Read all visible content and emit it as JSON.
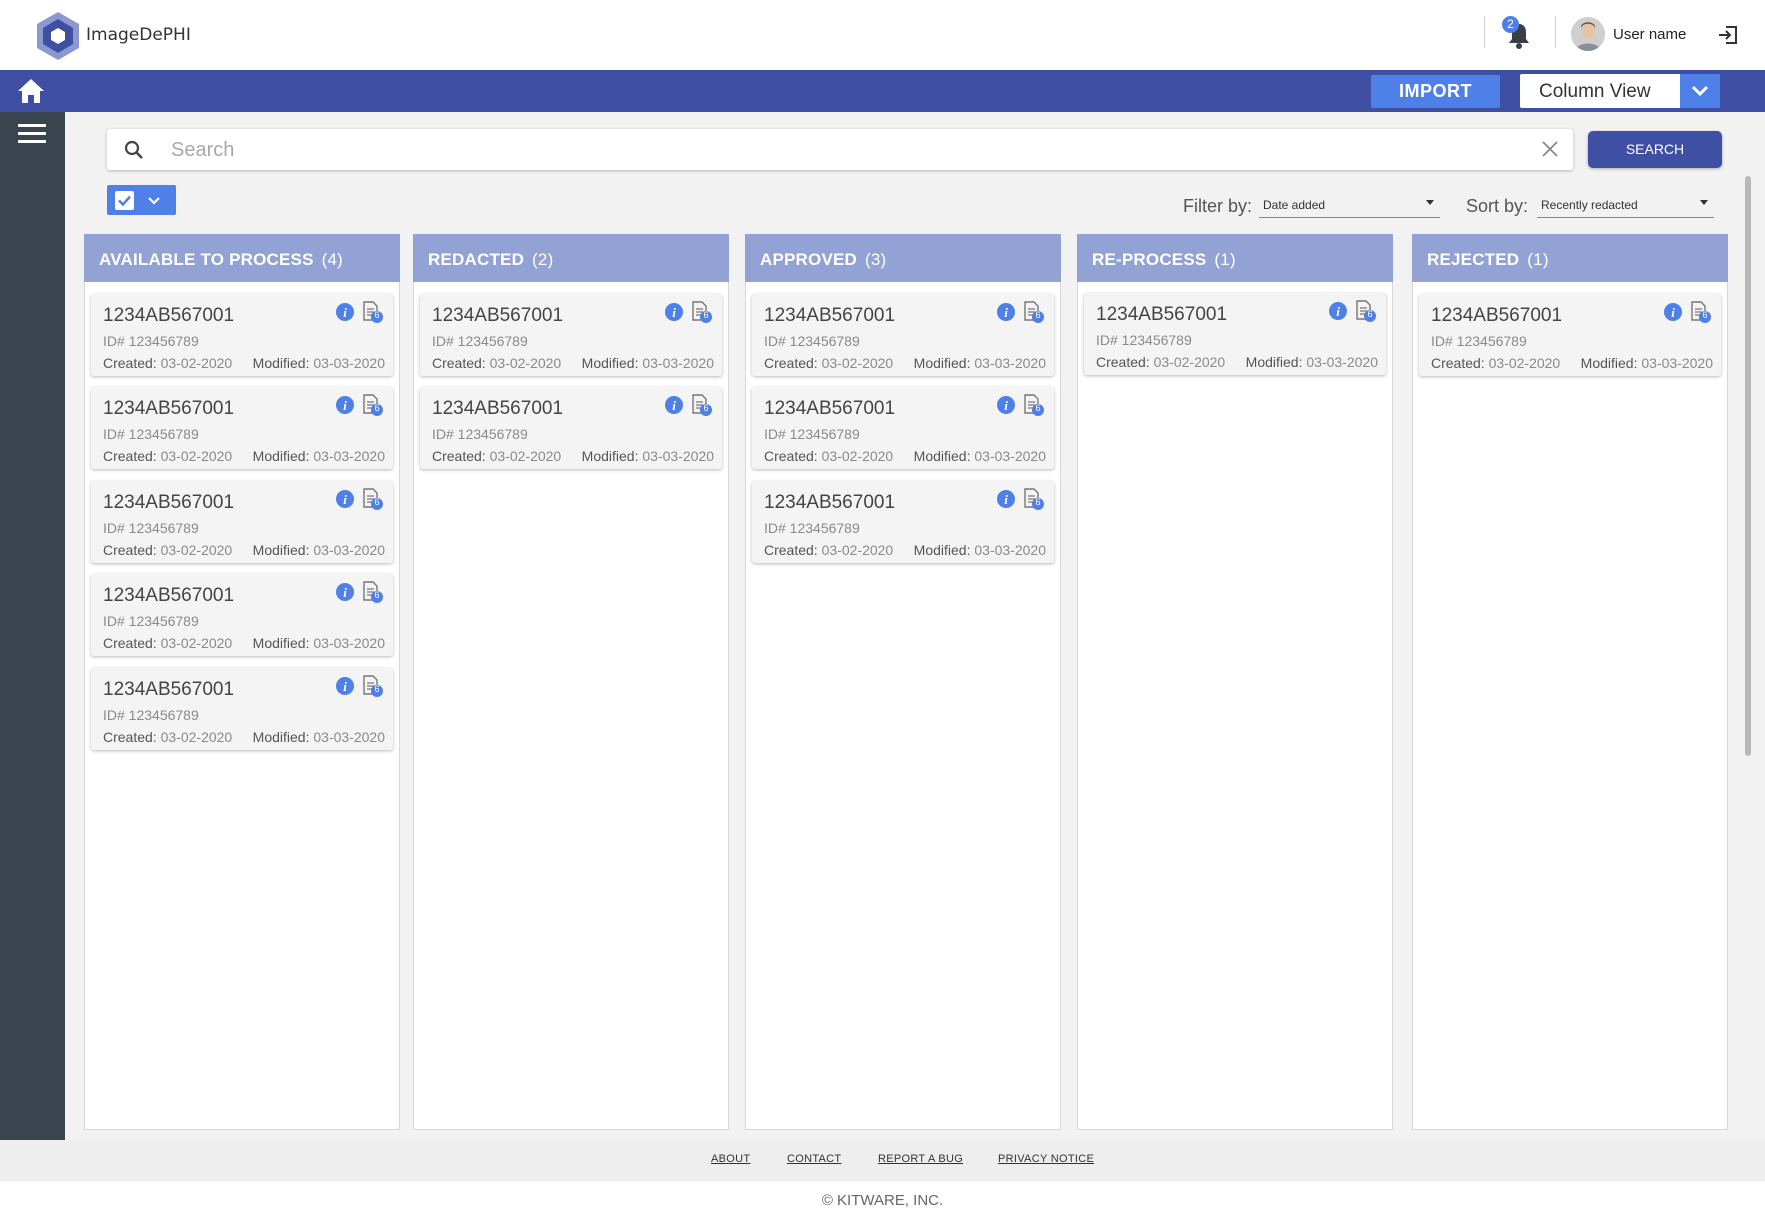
{
  "app": {
    "name": "ImageDePHI"
  },
  "header": {
    "notification_count": "2",
    "username": "User name"
  },
  "toolbar": {
    "import_label": "IMPORT",
    "view_selected": "Column View"
  },
  "search": {
    "placeholder": "Search",
    "button_label": "SEARCH"
  },
  "filter": {
    "label": "Filter by:",
    "value": "Date added"
  },
  "sort": {
    "label": "Sort by:",
    "value": "Recently redacted"
  },
  "card_template": {
    "name": "1234AB567001",
    "id": "ID# 123456789",
    "created_label": "Created:",
    "created": "03-02-2020",
    "modified_label": "Modified:",
    "modified": "03-03-2020",
    "doc_badge": "6"
  },
  "columns": [
    {
      "title": "AVAILABLE TO PROCESS",
      "count": "(4)"
    },
    {
      "title": "REDACTED",
      "count": "(2)"
    },
    {
      "title": "APPROVED",
      "count": "(3)"
    },
    {
      "title": "RE-PROCESS",
      "count": "(1)"
    },
    {
      "title": "REJECTED",
      "count": "(1)"
    }
  ],
  "column_card_counts": [
    5,
    2,
    3,
    1,
    1
  ],
  "footer": {
    "links": [
      "ABOUT",
      "CONTACT",
      "REPORT A BUG",
      "PRIVACY NOTICE"
    ],
    "copyright": "© KITWARE, INC."
  },
  "colors": {
    "navbar": "#3f4fa3",
    "accent": "#4f80e8",
    "column_header": "#93a2d4",
    "sidebar": "#39444e"
  },
  "icons": [
    "logo-icon",
    "bell-icon",
    "avatar",
    "logout-icon",
    "home-icon",
    "menu-icon",
    "search-icon",
    "clear-icon",
    "checkbox-icon",
    "chevron-down-icon",
    "info-icon",
    "document-icon"
  ]
}
